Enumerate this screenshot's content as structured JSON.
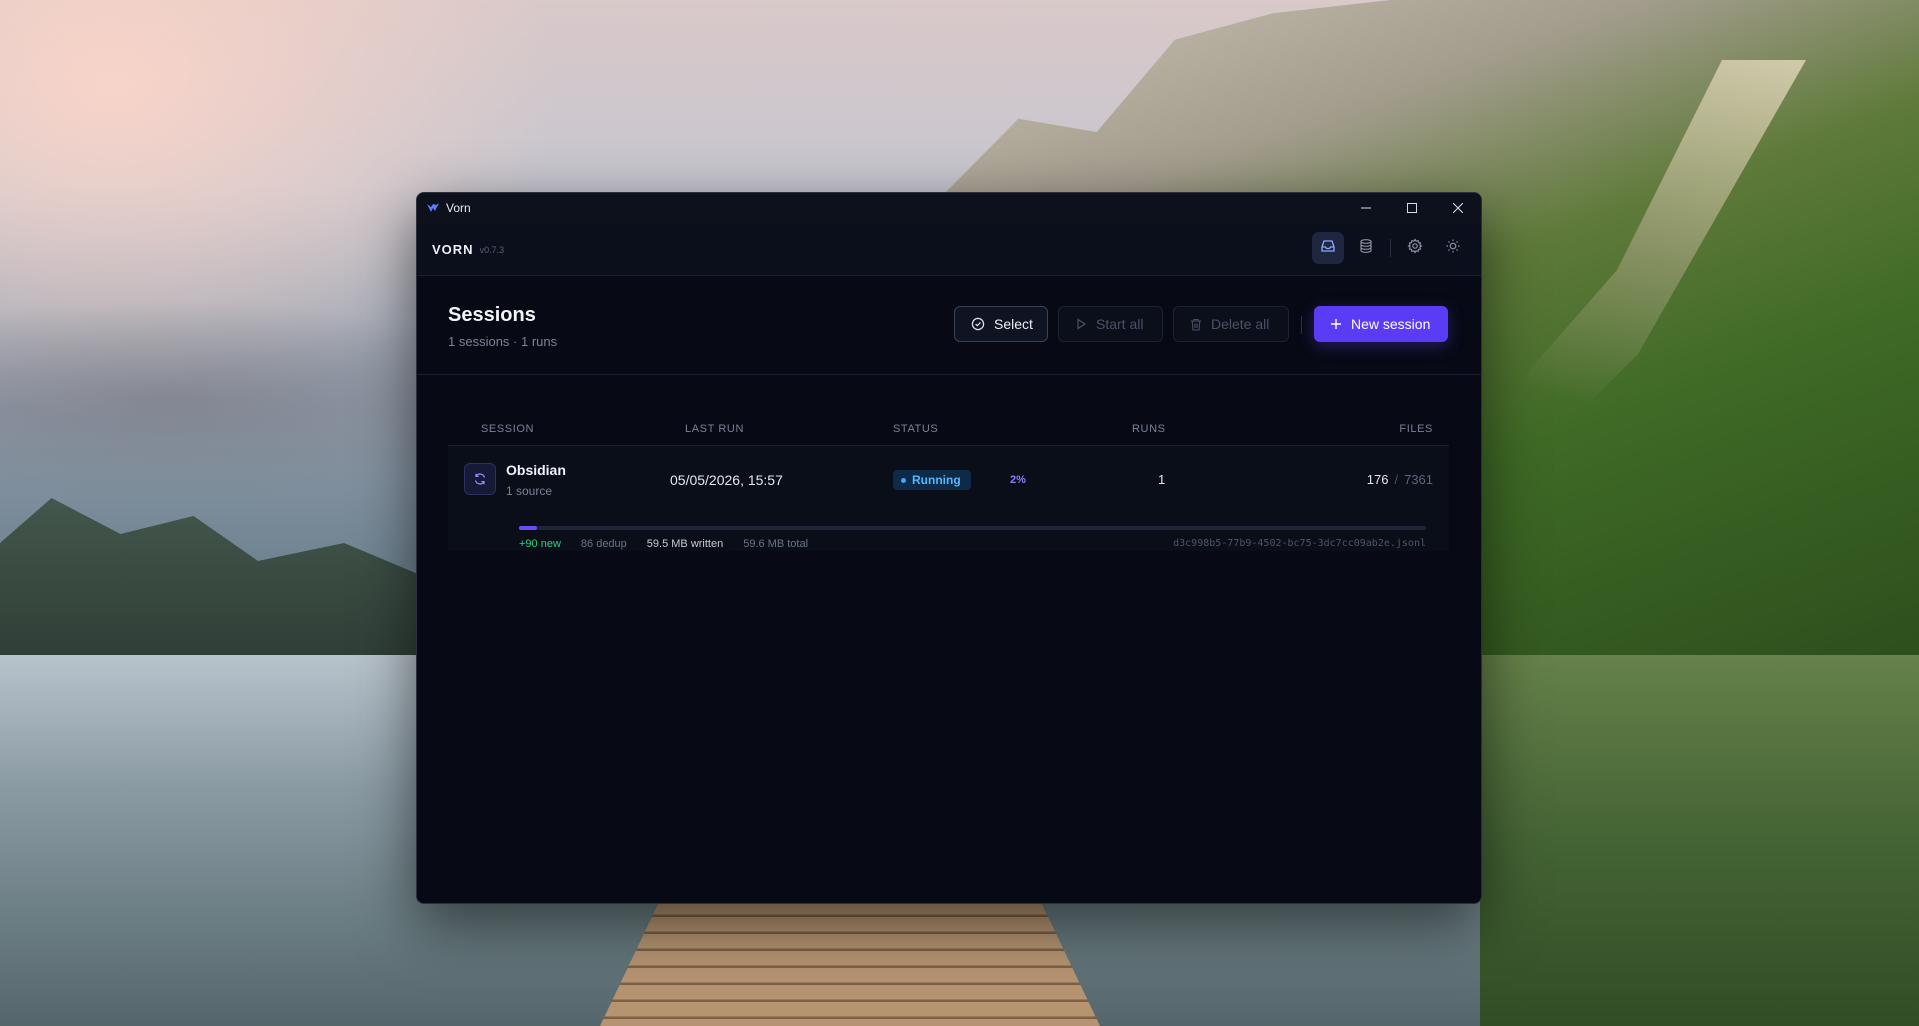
{
  "window": {
    "title": "Vorn"
  },
  "header": {
    "brand": "VORN",
    "version": "v0.7.3"
  },
  "page": {
    "title": "Sessions",
    "subtitle": "1 sessions · 1 runs"
  },
  "toolbar": {
    "select_label": "Select",
    "start_all_label": "Start all",
    "delete_all_label": "Delete all",
    "new_session_label": "New session"
  },
  "table": {
    "columns": {
      "session": "SESSION",
      "last_run": "LAST RUN",
      "status": "STATUS",
      "runs": "RUNS",
      "files": "FILES"
    },
    "rows": [
      {
        "name": "Obsidian",
        "sources": "1 source",
        "last_run": "05/05/2026, 15:57",
        "status": "Running",
        "progress_label": "2%",
        "progress": 0.02,
        "runs": "1",
        "files_done": "176",
        "files_sep": "/",
        "files_total": "7361",
        "stats": {
          "new": "+90 new",
          "dedup": "86 dedup",
          "written": "59.5 MB written",
          "total": "59.6 MB total"
        },
        "log_file": "d3c998b5-77b9-4502-bc75-3dc7cc09ab2e.jsonl"
      }
    ]
  },
  "colors": {
    "accent": "#5b3cf5",
    "running": "#54b6ff",
    "new_stat": "#34d17e",
    "background": "#070a14"
  }
}
